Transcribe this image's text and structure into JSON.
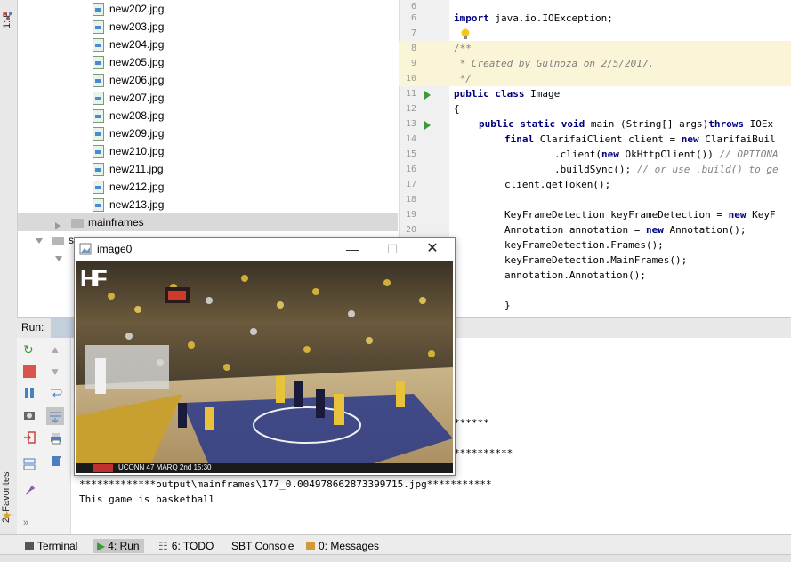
{
  "left_strip": {
    "project_tab_label": "1: P",
    "favorites_tab_label": "2: Favorites"
  },
  "project_tree": {
    "files": [
      "new202.jpg",
      "new203.jpg",
      "new204.jpg",
      "new205.jpg",
      "new206.jpg",
      "new207.jpg",
      "new208.jpg",
      "new209.jpg",
      "new210.jpg",
      "new211.jpg",
      "new212.jpg",
      "new213.jpg"
    ],
    "folder_mainframes": "mainframes",
    "partial_row_label": "s"
  },
  "editor": {
    "line_numbers": [
      "6",
      "7",
      "8",
      "9",
      "10",
      "11",
      "12",
      "13",
      "14",
      "15",
      "16",
      "17",
      "18",
      "19",
      "20",
      "21"
    ],
    "lines": {
      "l6": "import java.io.IOException;",
      "l9": "/**",
      "l10_prefix": " * Created by ",
      "l10_author": "Gulnoza",
      "l10_suffix": " on 2/5/2017.",
      "l11": " */",
      "l12_kw": "public class",
      "l12_name": " Image",
      "l13": "{",
      "l14_kw": "public static void",
      "l14_rest": " main (String[] args)",
      "l14_kw2": "throws",
      "l14_rest2": " IOEx",
      "l15_kw": "final",
      "l15_rest": " ClarifaiClient client = ",
      "l15_kw2": "new",
      "l15_rest2": " ClarifaiBuil",
      "l16_rest": ".client(",
      "l16_kw": "new",
      "l16_rest2": " OkHttpClient()) ",
      "l16_cm": "// OPTIONA",
      "l17_rest": ".buildSync(); ",
      "l17_cm": "// or use .build() to ge",
      "l18": "client.getToken();",
      "l20_rest": "KeyFrameDetection keyFrameDetection = ",
      "l20_kw": "new",
      "l20_rest2": " KeyF",
      "l21_rest": "Annotation annotation = ",
      "l21_kw": "new",
      "l21_rest2": " Annotation();",
      "l22": "keyFrameDetection.Frames();",
      "l23": "keyFrameDetection.MainFrames();",
      "l24": "annotation.Annotation();",
      "l26": "}"
    }
  },
  "run_panel": {
    "header_label": "Run:",
    "console_lines": {
      "stars1": "******",
      "stars2": "**********",
      "output_path": "*************output\\mainframes\\177_0.004978662873399715.jpg***********",
      "result": "This game is basketball"
    }
  },
  "bottom_tabs": {
    "terminal": "Terminal",
    "run": "4: Run",
    "todo": "6: TODO",
    "sbt": "SBT Console",
    "messages": "0: Messages"
  },
  "image_window": {
    "title": "image0",
    "logo": "HF",
    "scoreboard": "UCONN 47 MARQ 2nd 15:30"
  },
  "colors": {
    "keyword": "#000080",
    "comment": "#808080",
    "highlight_line": "#fbf5d8",
    "run_green": "#3c9a3c"
  }
}
